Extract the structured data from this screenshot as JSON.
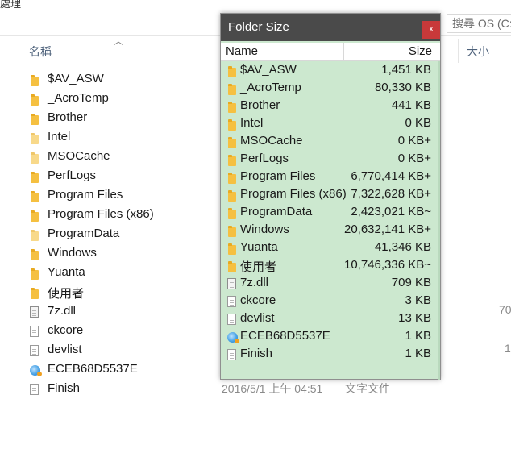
{
  "explorer": {
    "top_cut_text": "處理",
    "search_placeholder": "搜尋 OS (C:)",
    "columns": {
      "name": "名稱",
      "size": "大小"
    },
    "files": [
      {
        "name": "$AV_ASW",
        "icon": "folder-icon"
      },
      {
        "name": "_AcroTemp",
        "icon": "folder-icon"
      },
      {
        "name": "Brother",
        "icon": "folder-icon"
      },
      {
        "name": "Intel",
        "icon": "folder-icon-faded"
      },
      {
        "name": "MSOCache",
        "icon": "folder-icon-faded"
      },
      {
        "name": "PerfLogs",
        "icon": "folder-icon"
      },
      {
        "name": "Program Files",
        "icon": "folder-icon"
      },
      {
        "name": "Program Files (x86)",
        "icon": "folder-icon"
      },
      {
        "name": "ProgramData",
        "icon": "folder-icon-faded"
      },
      {
        "name": "Windows",
        "icon": "folder-icon"
      },
      {
        "name": "Yuanta",
        "icon": "folder-icon"
      },
      {
        "name": "使用者",
        "icon": "folder-icon"
      },
      {
        "name": "7z.dll",
        "icon": "dll-file-icon"
      },
      {
        "name": "ckcore",
        "icon": "file-icon"
      },
      {
        "name": "devlist",
        "icon": "file-icon"
      },
      {
        "name": "ECEB68D5537E",
        "icon": "globe-file-icon"
      },
      {
        "name": "Finish",
        "icon": "file-icon"
      }
    ],
    "finish_date": "2016/5/1 上午 04:51",
    "finish_type": "文字文件",
    "size_fragment_7z": "70",
    "size_fragment_devlist": "1"
  },
  "folder_size": {
    "title": "Folder Size",
    "close_label": "x",
    "col_name": "Name",
    "col_size": "Size",
    "colors": {
      "titlebar": "#4a4a4a",
      "body": "#cce8cf",
      "close": "#c8393a"
    },
    "rows": [
      {
        "name": "$AV_ASW",
        "size": "1,451 KB",
        "icon": "folder-icon"
      },
      {
        "name": "_AcroTemp",
        "size": "80,330 KB",
        "icon": "folder-icon"
      },
      {
        "name": "Brother",
        "size": "441 KB",
        "icon": "folder-icon"
      },
      {
        "name": "Intel",
        "size": "0 KB",
        "icon": "folder-icon"
      },
      {
        "name": "MSOCache",
        "size": "0 KB+",
        "icon": "folder-icon"
      },
      {
        "name": "PerfLogs",
        "size": "0 KB+",
        "icon": "folder-icon"
      },
      {
        "name": "Program Files",
        "size": "6,770,414 KB+",
        "icon": "folder-icon"
      },
      {
        "name": "Program Files (x86)",
        "size": "7,322,628 KB+",
        "icon": "folder-icon"
      },
      {
        "name": "ProgramData",
        "size": "2,423,021 KB~",
        "icon": "folder-icon"
      },
      {
        "name": "Windows",
        "size": "20,632,141 KB+",
        "icon": "folder-icon"
      },
      {
        "name": "Yuanta",
        "size": "41,346 KB",
        "icon": "folder-icon"
      },
      {
        "name": "使用者",
        "size": "10,746,336 KB~",
        "icon": "folder-icon"
      },
      {
        "name": "7z.dll",
        "size": "709 KB",
        "icon": "dll-file-icon"
      },
      {
        "name": "ckcore",
        "size": "3 KB",
        "icon": "file-icon"
      },
      {
        "name": "devlist",
        "size": "13 KB",
        "icon": "file-icon"
      },
      {
        "name": "ECEB68D5537E",
        "size": "1 KB",
        "icon": "globe-file-icon"
      },
      {
        "name": "Finish",
        "size": "1 KB",
        "icon": "file-icon"
      }
    ]
  }
}
